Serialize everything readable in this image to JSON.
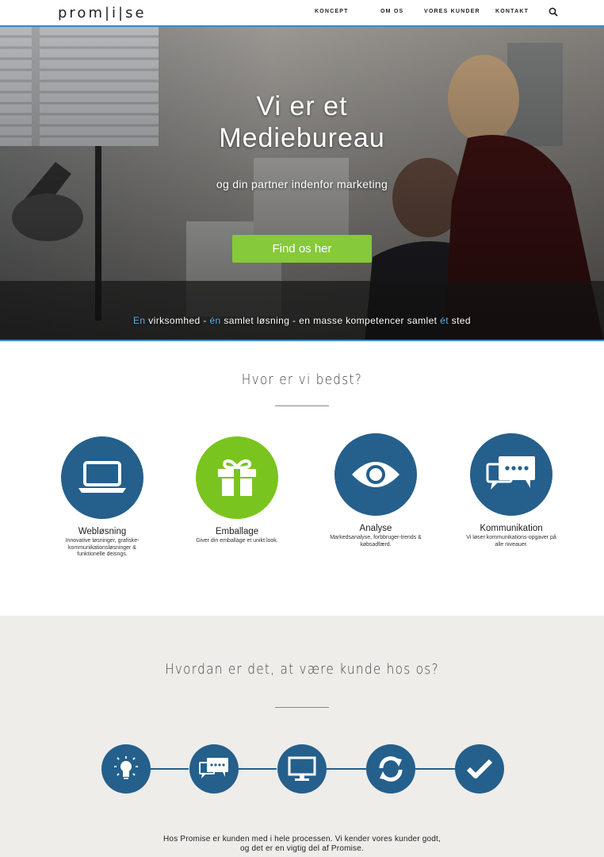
{
  "nav": {
    "logo": "prom|i|se",
    "items": [
      "KONCEPT",
      "OM OS",
      "VORES KUNDER",
      "KONTAKT"
    ]
  },
  "hero": {
    "title_line1": "Vi er et",
    "title_line2": "Mediebureau",
    "subtitle": "og din partner indenfor marketing",
    "cta": "Find os her",
    "tagline": {
      "p1": "En",
      "p2": " virksomhed - ",
      "p3": "én",
      "p4": " samlet løsning - en masse kompetencer samlet ",
      "p5": "ét",
      "p6": " sted"
    }
  },
  "services_section": {
    "title": "Hvor er vi bedst?",
    "items": [
      {
        "name": "Webløsning",
        "desc": "Innovative løsninger, grafiske-kommunikationsløsninger & funktionelle deisngs.",
        "icon": "laptop-icon",
        "color": "#255f8c"
      },
      {
        "name": "Emballage",
        "desc": "Giver din emballage et unikt look.",
        "icon": "gift-icon",
        "color": "#7ac41f"
      },
      {
        "name": "Analyse",
        "desc": "Markedsanalyse, forbbruger-trends & købsadfærd.",
        "icon": "eye-icon",
        "color": "#255f8c"
      },
      {
        "name": "Kommunikation",
        "desc": "Vi løser kommunikations-opgaver på alle niveauer.",
        "icon": "chat-icon",
        "color": "#255f8c"
      }
    ]
  },
  "process_section": {
    "title": "Hvordan er det, at være kunde hos os?",
    "steps": [
      "lightbulb-icon",
      "chat-icon",
      "monitor-icon",
      "refresh-icon",
      "checkmark-icon"
    ],
    "text_line1": "Hos Promise er kunden med i hele processen. Vi kender vores kunder godt,",
    "text_line2": "og det er en vigtig del af Promise."
  },
  "colors": {
    "accent_green": "#86c93a",
    "accent_blue": "#255f8c",
    "highlight_blue": "#5fb2ea",
    "grey_bg": "#eeede9"
  }
}
